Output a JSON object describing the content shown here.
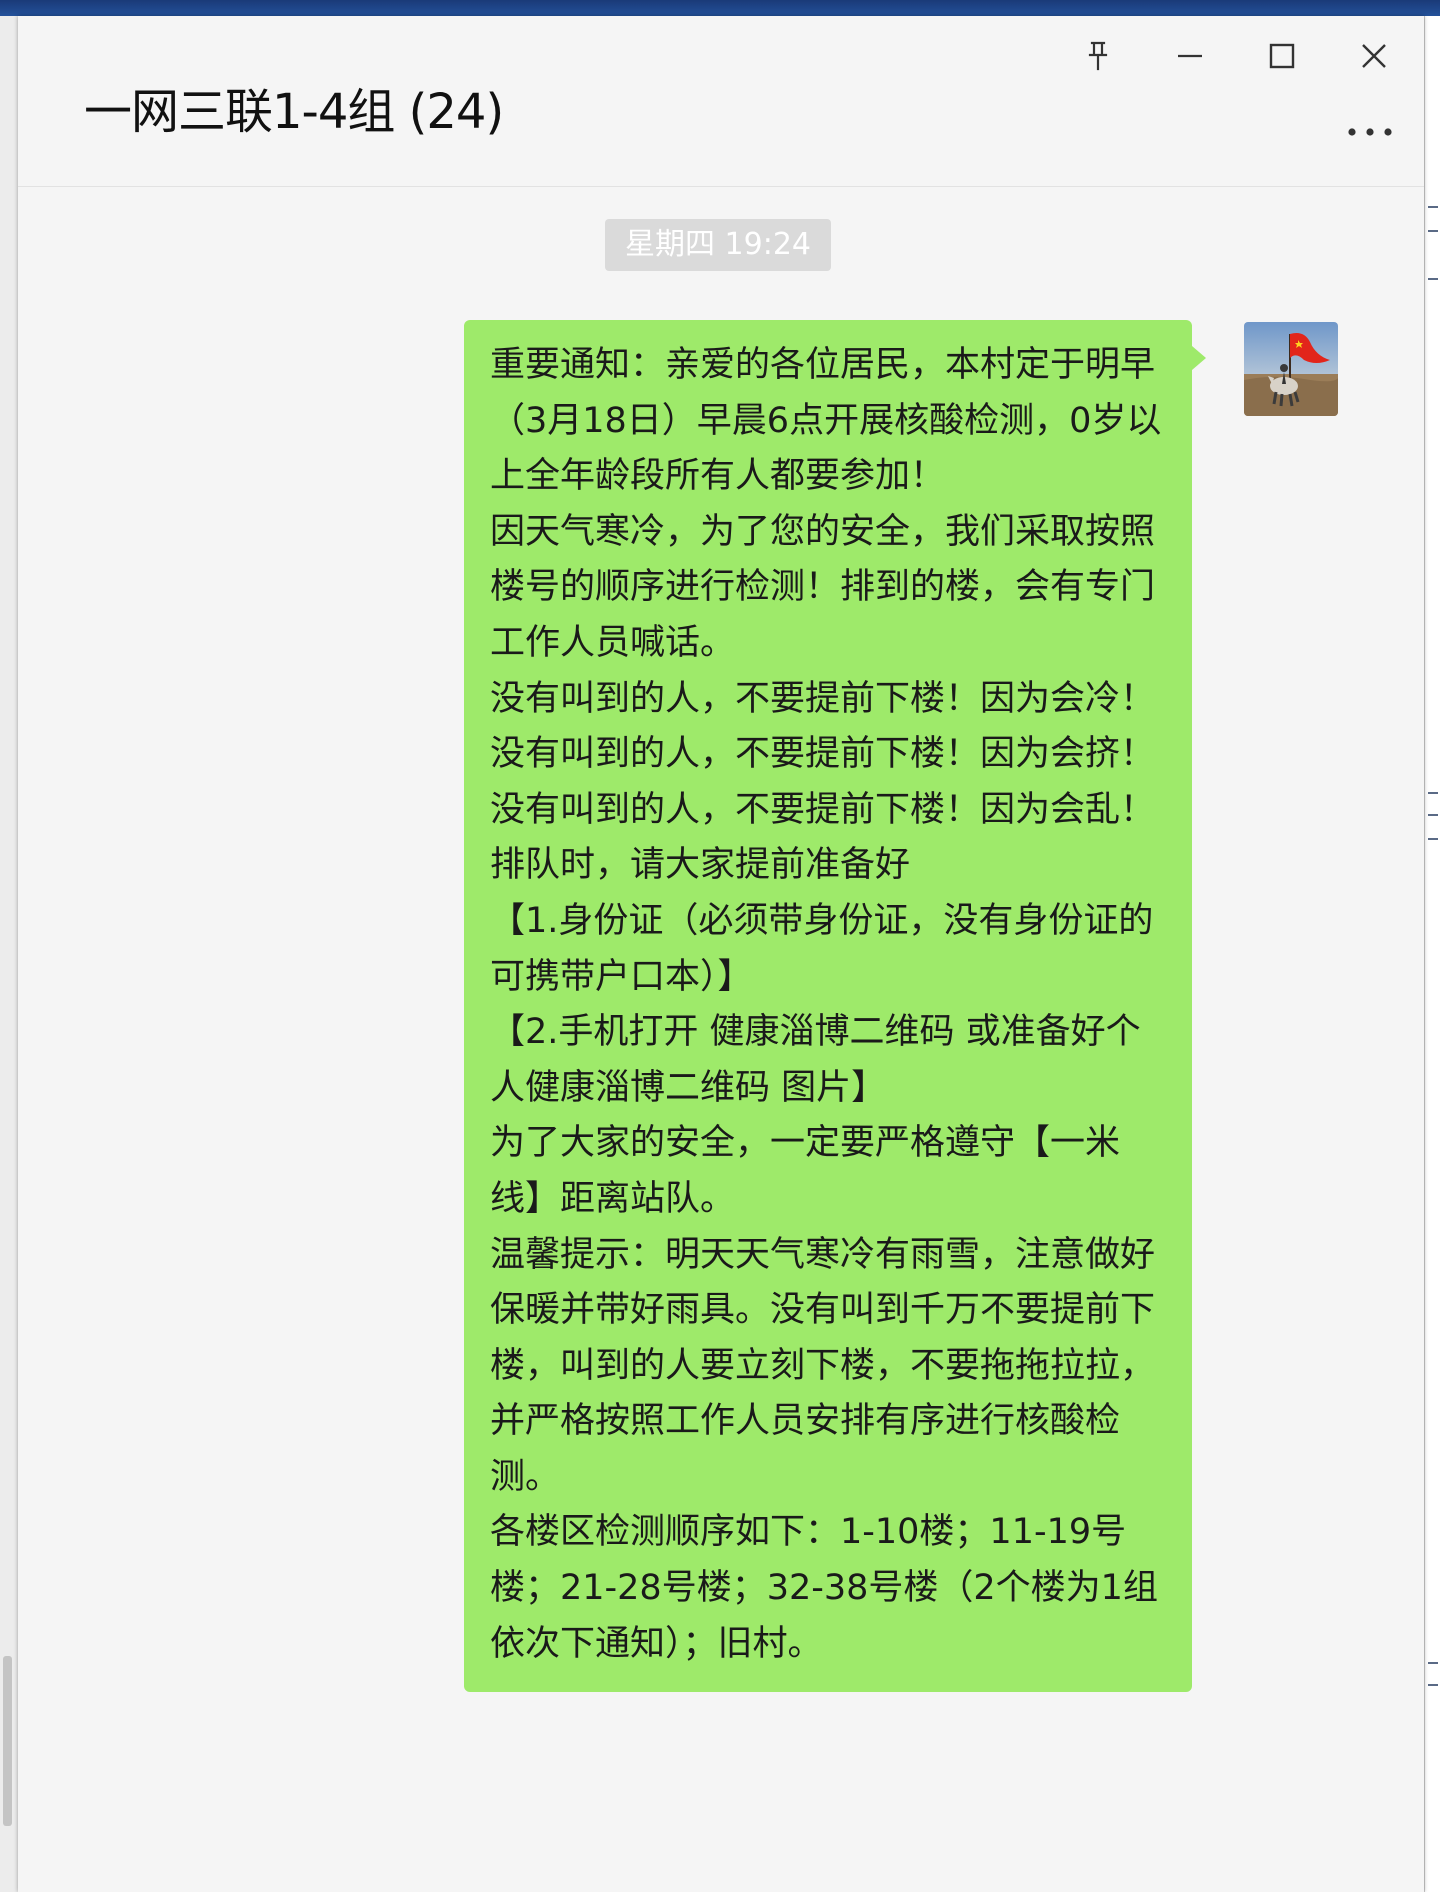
{
  "window": {
    "title": "一网三联1-4组 (24)"
  },
  "controls": {
    "pin_icon": "pin-icon",
    "minimize_icon": "minimize-icon",
    "maximize_icon": "maximize-icon",
    "close_icon": "close-icon",
    "more_icon": "more-icon"
  },
  "chat": {
    "timestamp": "星期四 19:24",
    "messages": [
      {
        "sender": "self",
        "bubble_color": "#9eea6a",
        "paragraphs": [
          "重要通知：亲爱的各位居民，本村定于明早（3月18日）早晨6点开展核酸检测，0岁以上全年龄段所有人都要参加！",
          "因天气寒冷，为了您的安全，我们采取按照楼号的顺序进行检测！排到的楼，会有专门工作人员喊话。",
          "没有叫到的人，不要提前下楼！因为会冷！",
          "没有叫到的人，不要提前下楼！因为会挤！",
          "没有叫到的人，不要提前下楼！因为会乱！",
          "排队时，请大家提前准备好",
          "【1.身份证（必须带身份证，没有身份证的可携带户口本）】",
          "【2.手机打开 健康淄博二维码 或准备好个人健康淄博二维码 图片】",
          "为了大家的安全，一定要严格遵守【一米线】距离站队。",
          "温馨提示：明天天气寒冷有雨雪，注意做好保暖并带好雨具。没有叫到千万不要提前下楼，叫到的人要立刻下楼，不要拖拖拉拉，并严格按照工作人员安排有序进行核酸检测。",
          "各楼区检测顺序如下：1-10楼；11-19号楼；21-28号楼；32-38号楼（2个楼为1组依次下通知）；旧村。"
        ]
      }
    ]
  },
  "colors": {
    "window_background": "#f5f5f5",
    "bubble_self": "#9eea6a",
    "timestamp_background": "#dadada"
  }
}
